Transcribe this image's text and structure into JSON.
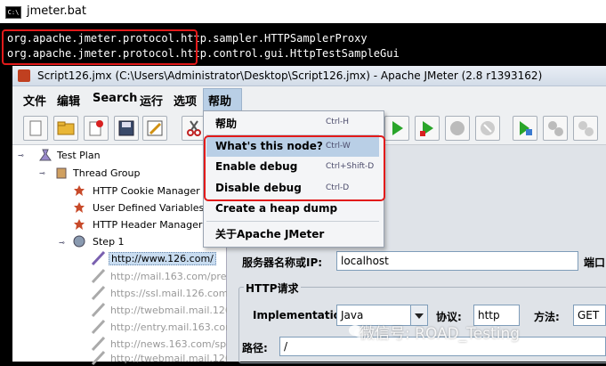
{
  "console": {
    "title": "jmeter.bat",
    "line1_highlight": "org.apache.jmeter.protocol",
    "line1_rest": ".http.sampler.HTTPSamplerProxy",
    "line2_highlight": "org.apache.jmeter.protocol",
    "line2_rest": ".http.control.gui.HttpTestSampleGui"
  },
  "window": {
    "title": "Script126.jmx (C:\\Users\\Administrator\\Desktop\\Script126.jmx) - Apache JMeter (2.8 r1393162)"
  },
  "menubar": {
    "items": [
      "文件",
      "编辑",
      "Search",
      "运行",
      "选项",
      "帮助"
    ]
  },
  "help_menu": {
    "items": [
      {
        "label": "帮助",
        "shortcut": "Ctrl-H"
      },
      {
        "label": "What's this node?",
        "shortcut": "Ctrl-W"
      },
      {
        "label": "Enable debug",
        "shortcut": "Ctrl+Shift-D"
      },
      {
        "label": "Disable debug",
        "shortcut": "Ctrl-D"
      },
      {
        "label": "Create a heap dump",
        "shortcut": ""
      },
      {
        "label": "关于Apache JMeter",
        "shortcut": ""
      }
    ]
  },
  "tree": {
    "nodes": [
      {
        "label": "Test Plan"
      },
      {
        "label": "Thread Group"
      },
      {
        "label": "HTTP Cookie Manager"
      },
      {
        "label": "User Defined Variables"
      },
      {
        "label": "HTTP Header Manager"
      },
      {
        "label": "Step 1"
      },
      {
        "label": "http://www.126.com/"
      },
      {
        "label": "http://mail.163.com/preloa"
      },
      {
        "label": "https://ssl.mail.126.com/e"
      },
      {
        "label": "http://twebmail.mail.126.c"
      },
      {
        "label": "http://entry.mail.163.com"
      },
      {
        "label": "http://news.163.com/spe"
      },
      {
        "label": "http://twebmail.mail.126.c"
      }
    ]
  },
  "form": {
    "server_label": "服务器名称或IP:",
    "server_value": "localhost",
    "port_label": "端口",
    "http_request_group": "HTTP请求",
    "implementation_label": "Implementation:",
    "implementation_value": "Java",
    "protocol_label": "协议:",
    "protocol_value": "http",
    "method_label": "方法:",
    "method_value": "GET",
    "path_label": "路径:",
    "path_value": "/"
  },
  "watermark": {
    "text": "微信号: ROAD_Testing"
  },
  "colors": {
    "highlight_red": "#e21a1a",
    "menu_selected": "#b9cfe6",
    "tree_selected": "#c8dcf0"
  }
}
